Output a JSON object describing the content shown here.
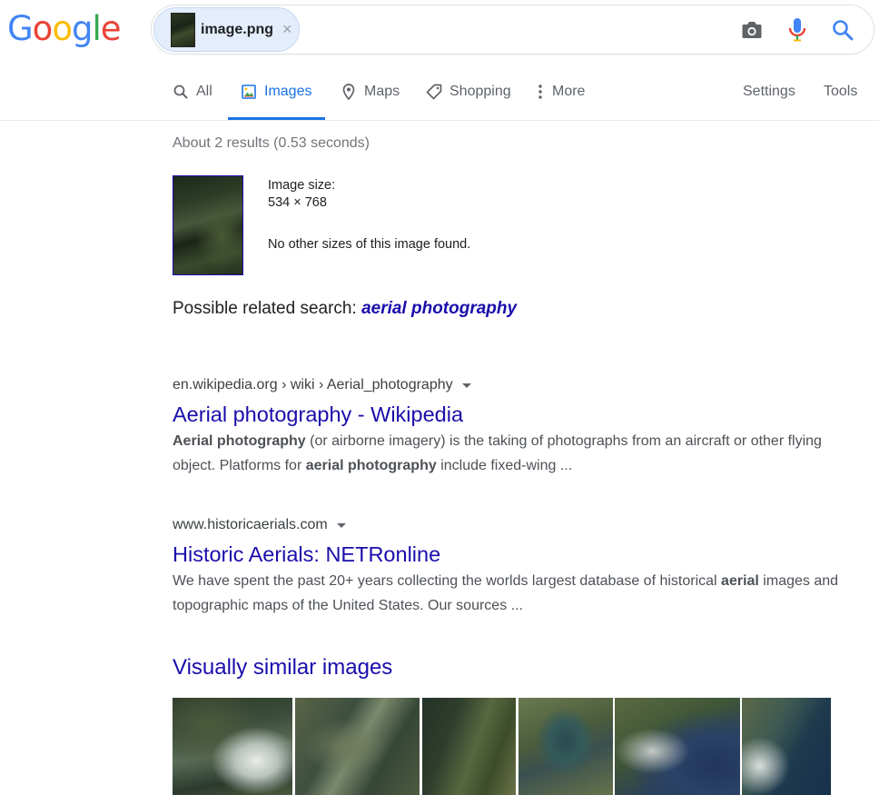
{
  "logo": {
    "letters": [
      "G",
      "o",
      "o",
      "g",
      "l",
      "e"
    ],
    "colors": [
      "#4285f4",
      "#ea4335",
      "#fbbc05",
      "#4285f4",
      "#34a853",
      "#ea4335"
    ]
  },
  "search": {
    "file_name": "image.png",
    "clear": "×"
  },
  "tabs": [
    {
      "label": "All",
      "icon": "search-icon"
    },
    {
      "label": "Images",
      "icon": "image-icon"
    },
    {
      "label": "Maps",
      "icon": "map-pin-icon"
    },
    {
      "label": "Shopping",
      "icon": "tag-icon"
    },
    {
      "label": "More",
      "icon": "more-vert-icon"
    }
  ],
  "right_tabs": {
    "settings": "Settings",
    "tools": "Tools"
  },
  "stats": "About 2 results (0.53 seconds)",
  "image_info": {
    "size_label": "Image size:",
    "size_value": "534 × 768",
    "no_other": "No other sizes of this image found."
  },
  "related": {
    "prefix": "Possible related search: ",
    "query": "aerial photography"
  },
  "results": [
    {
      "cite": "en.wikipedia.org › wiki › Aerial_photography",
      "title": "Aerial photography - Wikipedia",
      "snippet_html_parts": [
        {
          "b": "Aerial photography"
        },
        {
          "t": " (or airborne imagery) is the taking of photographs from an aircraft or other flying object. Platforms for "
        },
        {
          "b": "aerial photography"
        },
        {
          "t": " include fixed-wing ..."
        }
      ]
    },
    {
      "cite": "www.historicaerials.com",
      "title": "Historic Aerials: NETRonline",
      "snippet_html_parts": [
        {
          "t": "We have spent the past 20+ years collecting the worlds largest database of historical "
        },
        {
          "b": "aerial"
        },
        {
          "t": " images and topographic maps of the United States. Our sources ..."
        }
      ]
    }
  ],
  "visually_similar": {
    "heading": "Visually similar images",
    "count": 6
  }
}
